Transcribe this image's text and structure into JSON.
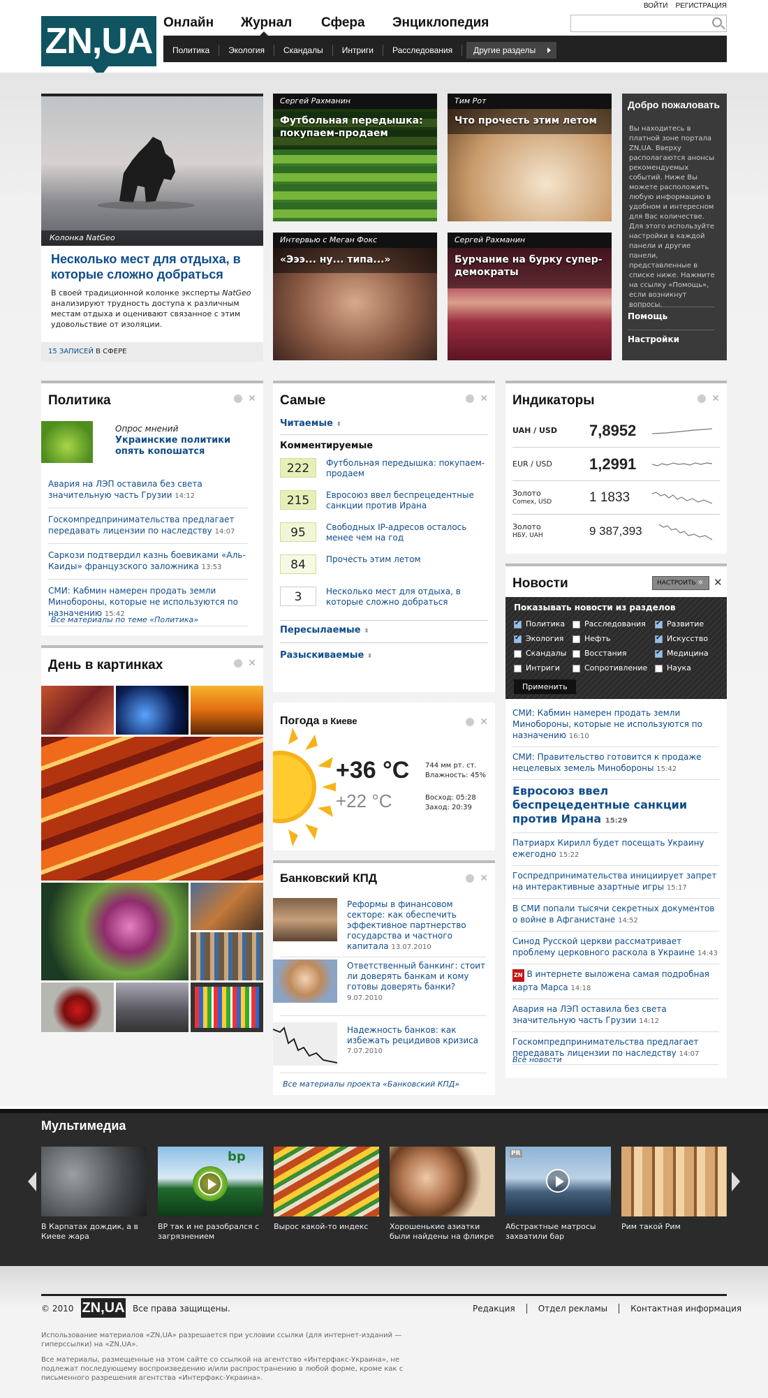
{
  "header": {
    "login": "ВОЙТИ",
    "register": "РЕГИСТРАЦИЯ",
    "logo": "ZN,UA",
    "main_nav": [
      "Онлайн",
      "Журнал",
      "Сфера",
      "Энциклопедия"
    ],
    "sub_nav": [
      "Политика",
      "Экология",
      "Скандалы",
      "Интриги",
      "Расследования"
    ],
    "other_sections": "Другие разделы",
    "search_placeholder": ""
  },
  "featured": {
    "natgeo": {
      "caption": "Колонка NatGeo",
      "title": "Несколько мест для отдыха, в которые сложно добраться",
      "text_before": "В своей традиционной колонке эксперты ",
      "text_em": "NatGeo",
      "text_after": " анализируют трудность доступа к различным местам отдыха и оценивают связанное с этим удовольствие от изоляции.",
      "records": "15 ЗАПИСЕЙ",
      "in_sphere": "В СФЕРЕ"
    },
    "tiles": [
      {
        "author": "Сергей Рахманин",
        "title": "Футбольная передышка: покупаем-продаем"
      },
      {
        "author": "Тим Рот",
        "title": "Что прочесть этим летом"
      },
      {
        "author": "Интервью с Меган Фокс",
        "title": "«Эээ... ну... типа...»"
      },
      {
        "author": "Сергей Рахманин",
        "title": "Бурчание на бурку супер-демократы"
      }
    ],
    "welcome": {
      "title": "Добро пожаловать",
      "text": "Вы находитесь в платной зоне портала ZN,UA. Вверху располагаются анонсы рекомендуемых событий. Ниже Вы можете расположить любую информацию в удобном и интересном для Вас количестве. Для этого используйте настройки в каждой панели и другие панели, представленные в списке ниже. Нажмите на ссылку «Помощь», если возникнут вопросы.",
      "help": "Помощь",
      "settings": "Настройки"
    }
  },
  "politics": {
    "title": "Политика",
    "poll_label": "Опрос мнений",
    "poll_title": "Украинские политики опять копошатся",
    "items": [
      {
        "text": "Авария на ЛЭП оставила без света значительную часть Грузии",
        "time": "14:12"
      },
      {
        "text": "Госкомпредпринимательства предлагает передавать лицензии по наследству",
        "time": "14:07"
      },
      {
        "text": "Саркози подтвердил казнь боевиками «Аль-Каиды» французского заложника",
        "time": "13:53"
      },
      {
        "text": "СМИ: Кабмин намерен продать земли Минобороны, которые не используются по назначению",
        "time": "15:42"
      }
    ],
    "all": "Все материалы по теме «Политика»"
  },
  "pictures": {
    "title": "День в картинках"
  },
  "most": {
    "title": "Самые",
    "read": "Читаемые",
    "commented": "Комментируемые",
    "items": [
      {
        "count": "222",
        "text": "Футбольная передышка: покупаем-продаем"
      },
      {
        "count": "215",
        "text": "Евросоюз ввел беспрецедентные санкции против Ирана"
      },
      {
        "count": "95",
        "text": "Свободных IP-адресов осталось менее чем на год"
      },
      {
        "count": "84",
        "text": "Прочесть этим летом"
      },
      {
        "count": "3",
        "text": "Несколько мест для отдыха, в которые сложно добраться"
      }
    ],
    "forwarded": "Пересылаемые",
    "searched": "Разыскиваемые"
  },
  "weather": {
    "title": "Погода",
    "city": "в Киеве",
    "temp_high": "+36 °C",
    "temp_low": "+22 °C",
    "pressure": "744 мм рт. ст.",
    "humidity": "Влажность: 45%",
    "sunrise": "Восход: 05:28",
    "sunset": "Заход: 20:39"
  },
  "bank": {
    "title": "Банковский КПД",
    "items": [
      {
        "text": "Реформы в финансовом секторе: как обеспечить эффективное партнерство государства и частного капитала",
        "date": "13.07.2010"
      },
      {
        "text": "Ответственный банкинг: стоит ли доверять банкам и кому готовы доверять банки?",
        "date": "9.07.2010"
      },
      {
        "text": "Надежность банков: как избежать рецидивов кризиса",
        "date": "7.07.2010"
      }
    ],
    "all": "Все материалы проекта «Банковский КПД»"
  },
  "indicators": {
    "title": "Индикаторы",
    "rows": [
      {
        "name": "UAH / USD",
        "sub": "",
        "value": "7,8952"
      },
      {
        "name": "EUR / USD",
        "sub": "",
        "value": "1,2991"
      },
      {
        "name": "Золото",
        "sub": "Comex, USD",
        "value": "1 1833"
      },
      {
        "name": "Золото",
        "sub": "НБУ, UAH",
        "value": "9 387,393"
      }
    ]
  },
  "news": {
    "title": "Новости",
    "configure": "НАСТРОИТЬ",
    "filter_title": "Показывать новости из разделов",
    "filters": [
      {
        "label": "Политика",
        "on": true
      },
      {
        "label": "Расследования",
        "on": false
      },
      {
        "label": "Развитие",
        "on": true
      },
      {
        "label": "Экология",
        "on": true
      },
      {
        "label": "Нефть",
        "on": false
      },
      {
        "label": "Искусство",
        "on": true
      },
      {
        "label": "Скандалы",
        "on": false
      },
      {
        "label": "Восстания",
        "on": false
      },
      {
        "label": "Медицина",
        "on": true
      },
      {
        "label": "Интриги",
        "on": false
      },
      {
        "label": "Сопротивление",
        "on": false
      },
      {
        "label": "Наука",
        "on": false
      }
    ],
    "apply": "Применить",
    "items": [
      {
        "text": "СМИ: Кабмин намерен продать земли Минобороны, которые не используются по назначению",
        "time": "16:10"
      },
      {
        "text": "СМИ: Правительство готовится к продаже нецелевых земель Минобороны",
        "time": "15:42"
      },
      {
        "text": "Евросоюз ввел беспрецедентные санкции против Ирана",
        "time": "15:29"
      },
      {
        "text": "Патриарх Кирилл будет посещать Украину ежегодно",
        "time": "15:22"
      },
      {
        "text": "Госпредпринимательства инициирует запрет на интерактивные азартные игры",
        "time": "15:17"
      },
      {
        "text": "В СМИ попали тысячи секретных документов о войне в Афганистане",
        "time": "14:52"
      },
      {
        "text": "Синод Русской церкви рассматривает проблему церковного раскола в Украине",
        "time": "14:43"
      },
      {
        "text": "В интернете выложена самая подробная карта Марса",
        "time": "14:18"
      },
      {
        "text": "Авария на ЛЭП оставила без света значительную часть Грузии",
        "time": "14:12"
      },
      {
        "text": "Госкомпредпринимательства предлагает передавать лицензии по наследству",
        "time": "14:07"
      }
    ],
    "zn_badge": "ZN",
    "all": "Все новости"
  },
  "multimedia": {
    "title": "Мультимедиа",
    "items": [
      {
        "text": "В Карпатах дождик, а в Киеве жара"
      },
      {
        "text": "BP так и не разобрался с загрязнением"
      },
      {
        "text": "Вырос какой-то индекс"
      },
      {
        "text": "Хорошенькие азиатки были найдены на фликре"
      },
      {
        "text": "Абстрактные матросы захватили бар"
      },
      {
        "text": "Рим такой Рим"
      }
    ],
    "bp": "bp",
    "pr": "PR"
  },
  "footer": {
    "copyright": "© 2010",
    "logo": "ZN,UA",
    "rights": "Все права защищены.",
    "links": [
      "Редакция",
      "Отдел рекламы",
      "Контактная информация"
    ],
    "note1": "Использование материалов «ZN,UA» разрешается при условии ссылки (для интернет-изданий — гиперссылки) на «ZN,UA».",
    "note2": "Все материалы, размещенные на этом сайте со ссылкой на агентство «Интерфакс-Украина», не подлежат последующему воспроизведению и/или распространению в любой форме, кроме как с письменного разрешения агентства «Интерфакс-Украина»."
  }
}
